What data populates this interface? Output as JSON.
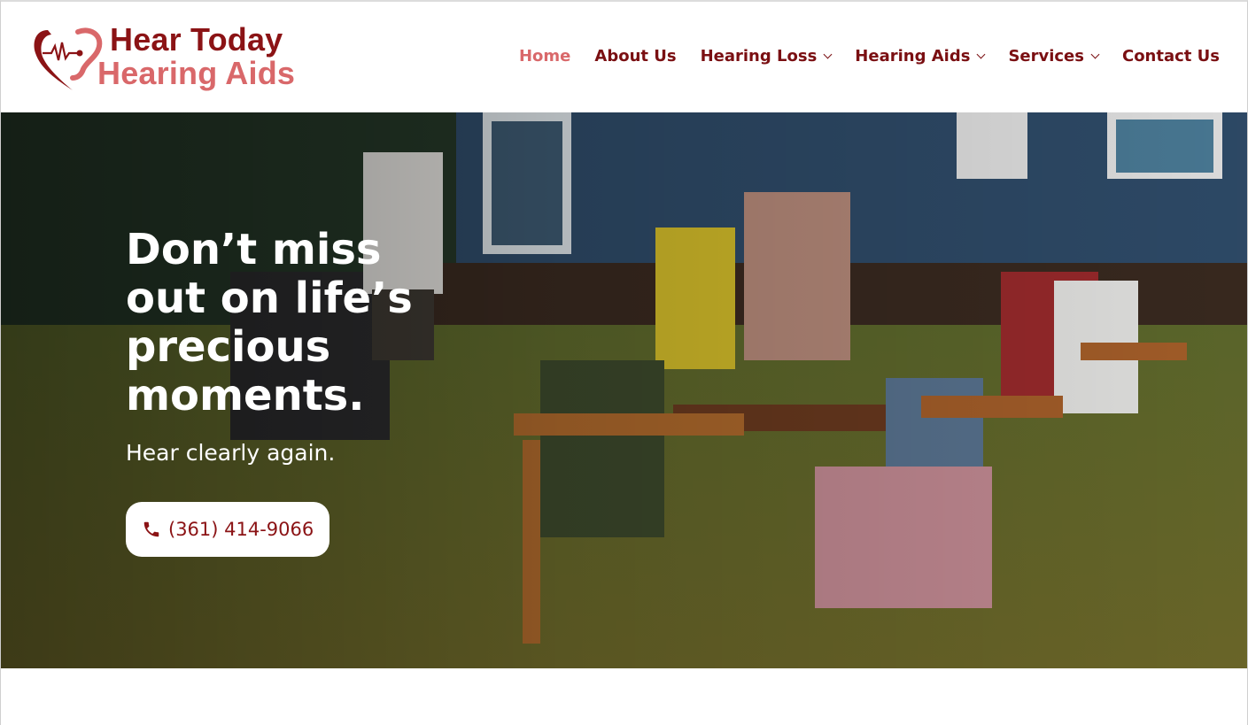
{
  "brand": {
    "line1": "Hear Today",
    "line2": "Hearing Aids",
    "primary_color": "#8b1315",
    "accent_color": "#d9686a"
  },
  "nav": {
    "items": [
      {
        "label": "Home",
        "active": true,
        "has_dropdown": false
      },
      {
        "label": "About Us",
        "active": false,
        "has_dropdown": false
      },
      {
        "label": "Hearing Loss",
        "active": false,
        "has_dropdown": true
      },
      {
        "label": "Hearing Aids",
        "active": false,
        "has_dropdown": true
      },
      {
        "label": "Services",
        "active": false,
        "has_dropdown": true
      },
      {
        "label": "Contact Us",
        "active": false,
        "has_dropdown": false
      }
    ]
  },
  "hero": {
    "title": "Don’t miss out on life’s precious moments.",
    "subtitle": "Hear clearly again.",
    "phone_label": "(361) 414-9066",
    "phone_icon": "phone-icon"
  }
}
